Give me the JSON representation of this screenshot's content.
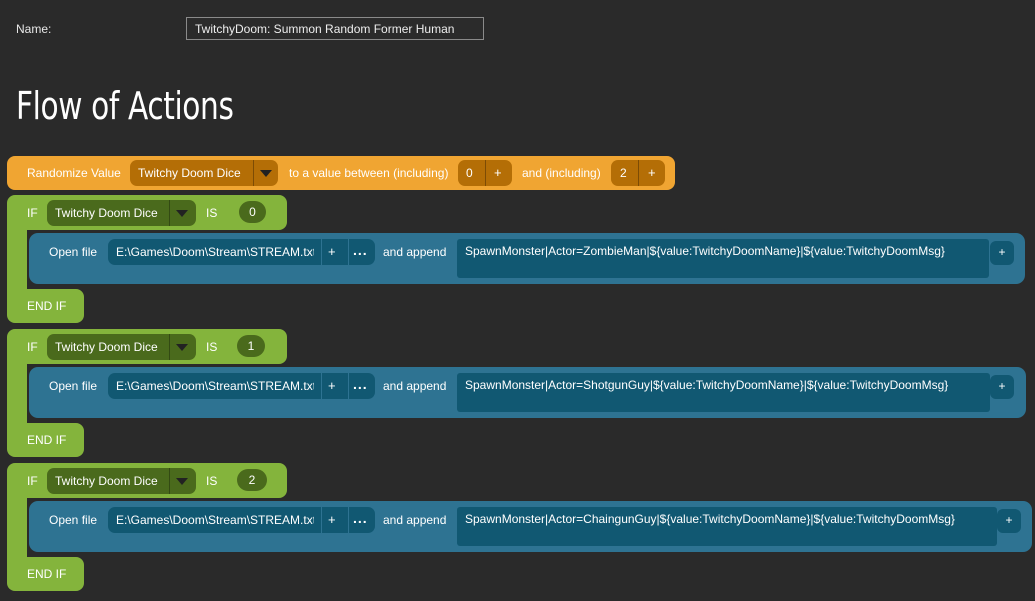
{
  "header": {
    "name_label": "Name:",
    "name_value": "TwitchyDoom: Summon Random Former Human",
    "section_title": "Flow of Actions"
  },
  "randomize": {
    "label": "Randomize Value",
    "variable": "Twitchy Doom Dice",
    "between_label": "to a value between (including)",
    "min": "0",
    "and_label": "and (including)",
    "max": "2",
    "plus": "+"
  },
  "if_blocks": [
    {
      "if_label": "IF",
      "variable": "Twitchy Doom Dice",
      "is_label": "IS",
      "value": "0",
      "open_label": "Open file",
      "file_path": "E:\\Games\\Doom\\Stream\\STREAM.txt",
      "plus": "+",
      "more": "...",
      "append_label": "and append",
      "append_text": "SpawnMonster|Actor=ZombieMan|${value:TwitchyDoomName}|${value:TwitchyDoomMsg}",
      "append_plus": "+",
      "end_label": "END IF"
    },
    {
      "if_label": "IF",
      "variable": "Twitchy Doom Dice",
      "is_label": "IS",
      "value": "1",
      "open_label": "Open file",
      "file_path": "E:\\Games\\Doom\\Stream\\STREAM.txt",
      "plus": "+",
      "more": "...",
      "append_label": "and append",
      "append_text": "SpawnMonster|Actor=ShotgunGuy|${value:TwitchyDoomName}|${value:TwitchyDoomMsg}",
      "append_plus": "+",
      "end_label": "END IF"
    },
    {
      "if_label": "IF",
      "variable": "Twitchy Doom Dice",
      "is_label": "IS",
      "value": "2",
      "open_label": "Open file",
      "file_path": "E:\\Games\\Doom\\Stream\\STREAM.txt",
      "plus": "+",
      "more": "...",
      "append_label": "and append",
      "append_text": "SpawnMonster|Actor=ChaingunGuy|${value:TwitchyDoomName}|${value:TwitchyDoomMsg}",
      "append_plus": "+",
      "end_label": "END IF"
    }
  ],
  "colors": {
    "background": "#2a2a2a",
    "randomize_block": "#f0a532",
    "if_block": "#84b43c",
    "action_block": "#2e7392",
    "action_field": "#115872"
  }
}
